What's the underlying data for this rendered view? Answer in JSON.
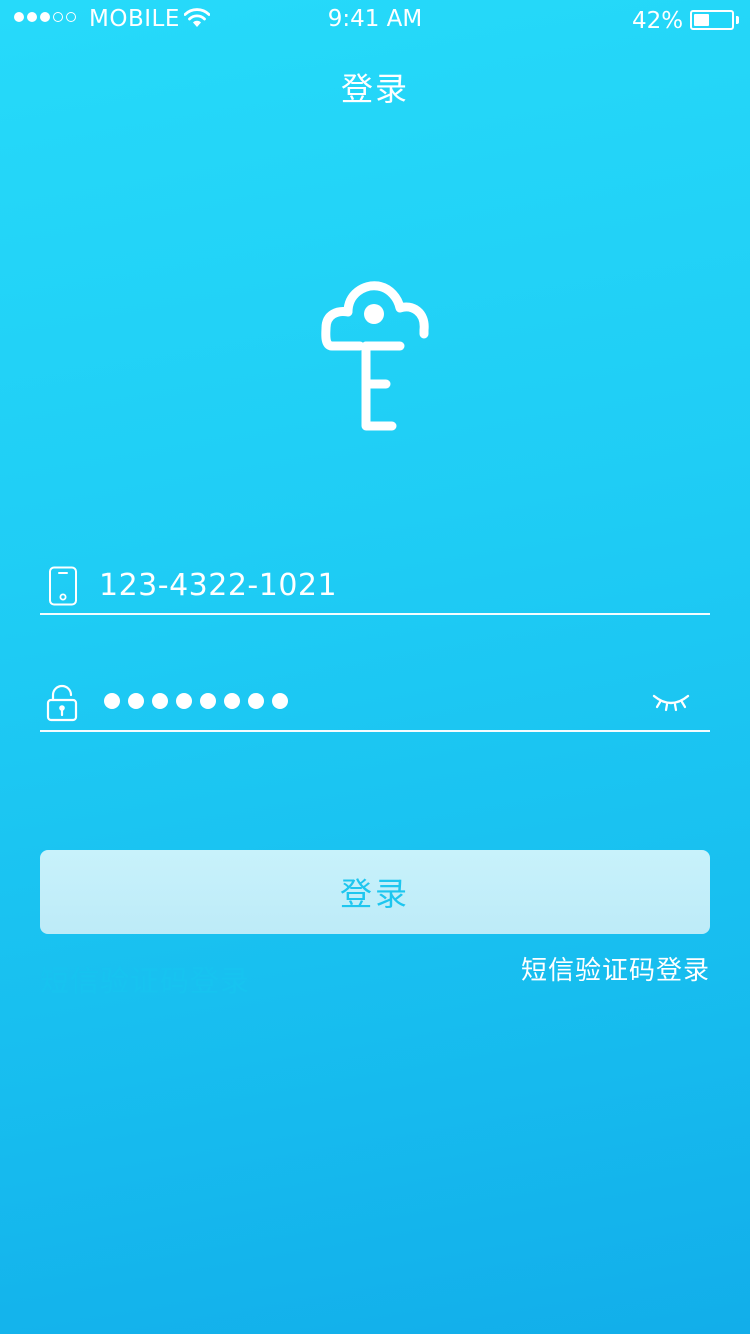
{
  "status_bar": {
    "carrier": "MOBILE",
    "time": "9:41 AM",
    "battery_percent": "42%",
    "battery_level": 0.42,
    "signal_bars_filled": 3,
    "signal_bars_total": 5
  },
  "nav": {
    "title": "登录"
  },
  "logo": {
    "icon": "cloud-key-icon"
  },
  "form": {
    "phone": {
      "icon": "phone-icon",
      "value": "123-4322-1021"
    },
    "password": {
      "icon": "lock-icon",
      "masked_length": 8,
      "visibility_icon": "eye-closed-icon"
    }
  },
  "actions": {
    "login_label": "登录",
    "sms_login_label": "短信验证码登录",
    "sms_login_faded_label": "短信验证码登录"
  },
  "colors": {
    "background_top": "#26dafa",
    "background_bottom": "#12aeea",
    "button_bg": "#c8f2fb",
    "button_text": "#1ec6ef",
    "text": "#ffffff"
  }
}
